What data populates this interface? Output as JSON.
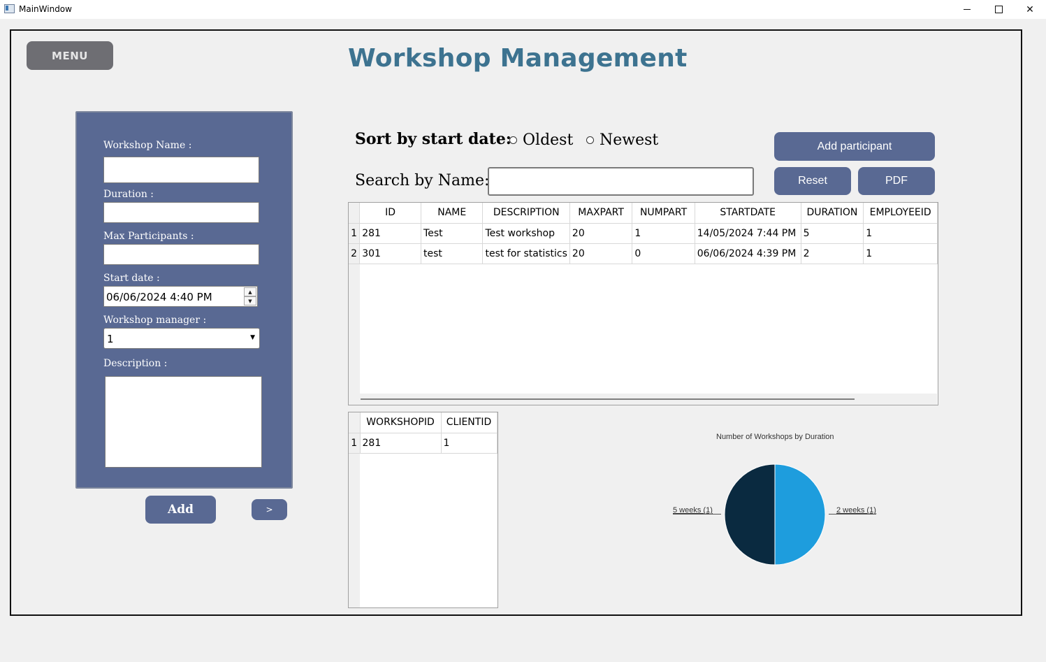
{
  "window": {
    "title": "MainWindow"
  },
  "header": {
    "menu_label": "MENU",
    "title": "Workshop Management"
  },
  "form": {
    "name_label": "Workshop Name :",
    "duration_label": "Duration :",
    "max_participants_label": "Max Participants :",
    "start_date_label": "Start date :",
    "start_date_value": "06/06/2024 4:40 PM",
    "manager_label": "Workshop manager :",
    "manager_value": "1",
    "description_label": "Description :",
    "add_label": "Add",
    "next_label": ">"
  },
  "sort": {
    "label": "Sort by start date:",
    "oldest": "Oldest",
    "newest": "Newest"
  },
  "search": {
    "label": "Search by Name:",
    "value": ""
  },
  "buttons": {
    "add_participant": "Add participant",
    "reset": "Reset",
    "pdf": "PDF"
  },
  "workshops_table": {
    "columns": [
      "ID",
      "NAME",
      "DESCRIPTION",
      "MAXPART",
      "NUMPART",
      "STARTDATE",
      "DURATION",
      "EMPLOYEEID"
    ],
    "rows": [
      {
        "num": "1",
        "cells": [
          "281",
          "Test",
          "Test workshop",
          "20",
          "1",
          "14/05/2024 7:44 PM",
          "5",
          "1"
        ]
      },
      {
        "num": "2",
        "cells": [
          "301",
          "test",
          "test for statistics",
          "20",
          "0",
          "06/06/2024 4:39 PM",
          "2",
          "1"
        ]
      }
    ]
  },
  "participants_table": {
    "columns": [
      "WORKSHOPID",
      "CLIENTID"
    ],
    "rows": [
      {
        "num": "1",
        "cells": [
          "281",
          "1"
        ]
      }
    ]
  },
  "chart_data": {
    "type": "pie",
    "title": "Number of Workshops by Duration",
    "categories": [
      "5 weeks (1)",
      "2 weeks (1)"
    ],
    "values": [
      1,
      1
    ],
    "colors": [
      "#0a2a40",
      "#1e9ddd"
    ]
  }
}
